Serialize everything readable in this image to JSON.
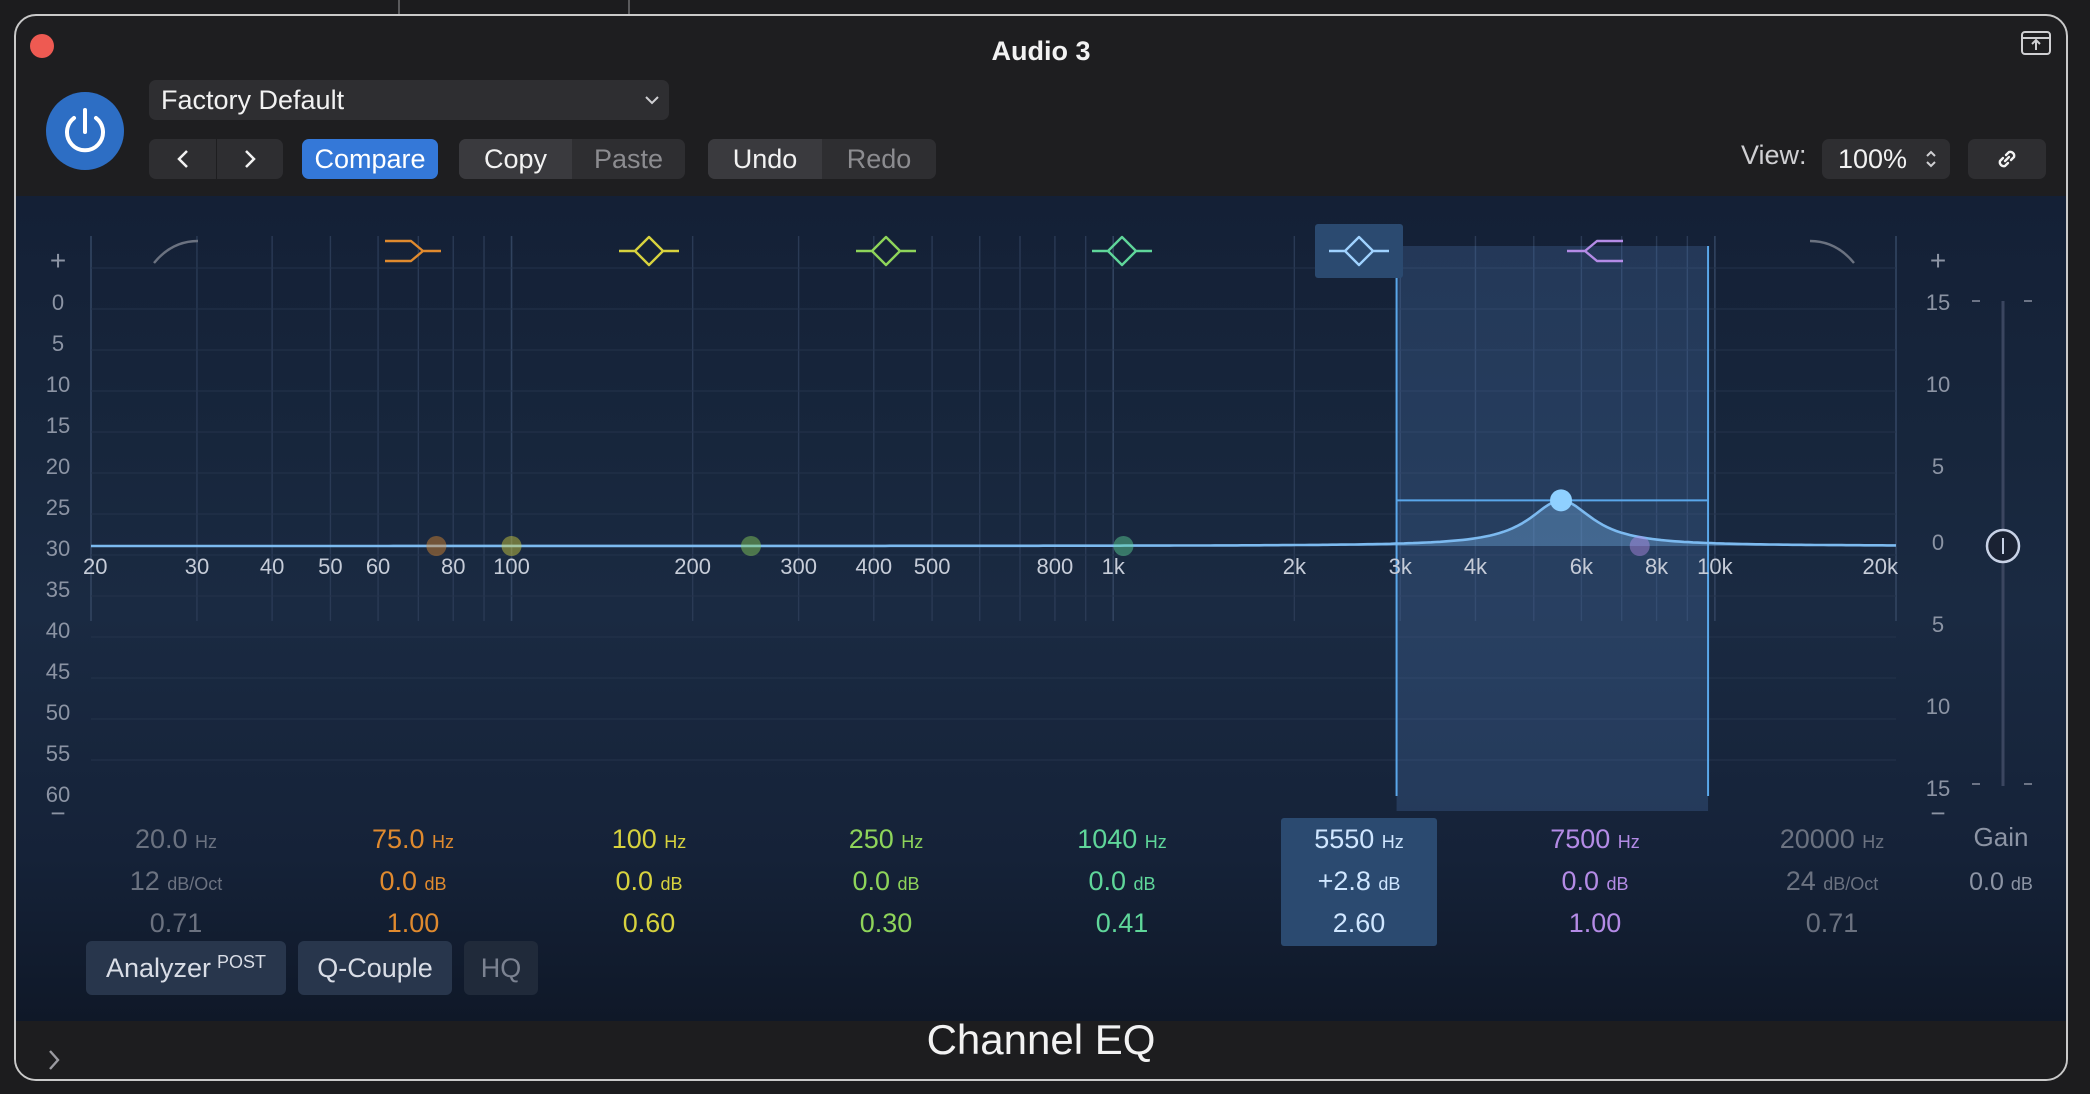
{
  "window": {
    "title": "Audio 3"
  },
  "header": {
    "preset": "Factory Default",
    "compare_label": "Compare",
    "copy_label": "Copy",
    "paste_label": "Paste",
    "undo_label": "Undo",
    "redo_label": "Redo",
    "view_label": "View:",
    "view_value": "100%"
  },
  "eq": {
    "freq_labels": [
      "20",
      "30",
      "40",
      "50",
      "60",
      "80",
      "100",
      "200",
      "300",
      "400",
      "500",
      "800",
      "1k",
      "2k",
      "3k",
      "4k",
      "6k",
      "8k",
      "10k",
      "20k"
    ],
    "left_scale_plus": "+",
    "left_scale_minus": "−",
    "left_scale": [
      "0",
      "5",
      "10",
      "15",
      "20",
      "25",
      "30",
      "35",
      "40",
      "45",
      "50",
      "55",
      "60"
    ],
    "right_scale_plus": "+",
    "right_scale_minus": "−",
    "right_scale": [
      "15",
      "10",
      "5",
      "0",
      "5",
      "10",
      "15"
    ],
    "bands": [
      {
        "freq": "20.0",
        "funit": "Hz",
        "gain": "12",
        "gunit": "dB/Oct",
        "q": "0.71",
        "color": "#6b7280",
        "type": "low-cut-icon"
      },
      {
        "freq": "75.0",
        "funit": "Hz",
        "gain": "0.0",
        "gunit": "dB",
        "q": "1.00",
        "color": "#e08a2e",
        "type": "low-shelf-icon"
      },
      {
        "freq": "100",
        "funit": "Hz",
        "gain": "0.0",
        "gunit": "dB",
        "q": "0.60",
        "color": "#d7d23e",
        "type": "bell-icon"
      },
      {
        "freq": "250",
        "funit": "Hz",
        "gain": "0.0",
        "gunit": "dB",
        "q": "0.30",
        "color": "#8ed45a",
        "type": "bell-icon"
      },
      {
        "freq": "1040",
        "funit": "Hz",
        "gain": "0.0",
        "gunit": "dB",
        "q": "0.41",
        "color": "#5fd69a",
        "type": "bell-icon"
      },
      {
        "freq": "5550",
        "funit": "Hz",
        "gain": "+2.8",
        "gunit": "dB",
        "q": "2.60",
        "color": "#7fc7f5",
        "type": "bell-icon"
      },
      {
        "freq": "7500",
        "funit": "Hz",
        "gain": "0.0",
        "gunit": "dB",
        "q": "1.00",
        "color": "#b48be6",
        "type": "high-shelf-icon"
      },
      {
        "freq": "20000",
        "funit": "Hz",
        "gain": "24",
        "gunit": "dB/Oct",
        "q": "0.71",
        "color": "#6b7280",
        "type": "high-cut-icon"
      }
    ],
    "gain_label": "Gain",
    "gain_value": "0.0",
    "gain_unit": "dB"
  },
  "options": {
    "analyzer_label": "Analyzer",
    "analyzer_sup": "POST",
    "qcouple_label": "Q-Couple",
    "hq_label": "HQ"
  },
  "footer": {
    "title": "Channel EQ"
  }
}
